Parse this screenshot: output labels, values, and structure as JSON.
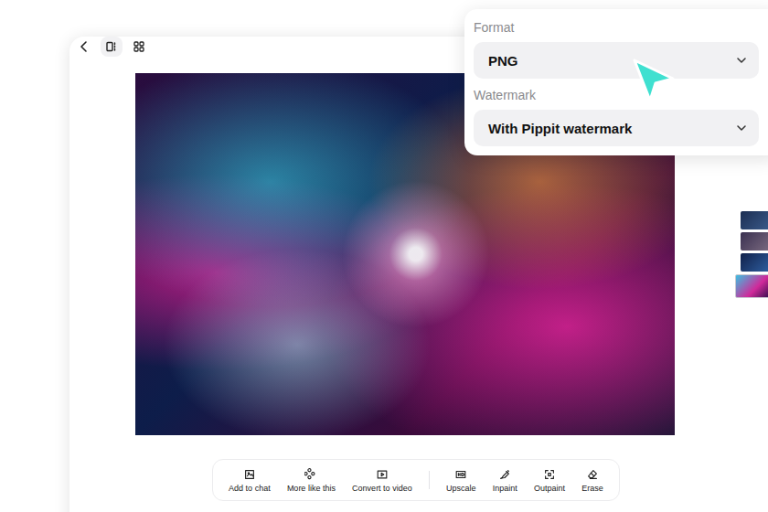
{
  "viewer": {
    "view_toggles": [
      {
        "kind": "single",
        "selected": true
      },
      {
        "kind": "grid",
        "selected": false
      }
    ],
    "thumbnails": [
      {
        "selected": false
      },
      {
        "selected": false
      },
      {
        "selected": false
      },
      {
        "selected": true
      }
    ],
    "toolbar": {
      "groups": [
        [
          {
            "label": "Add to chat"
          },
          {
            "label": "More like this"
          },
          {
            "label": "Convert to video"
          }
        ],
        [
          {
            "label": "Upscale"
          },
          {
            "label": "Inpaint"
          },
          {
            "label": "Outpaint"
          },
          {
            "label": "Erase"
          }
        ]
      ]
    }
  },
  "export_panel": {
    "fields": [
      {
        "label": "Format",
        "value": "PNG"
      },
      {
        "label": "Watermark",
        "value": "With Pippit watermark"
      }
    ]
  }
}
